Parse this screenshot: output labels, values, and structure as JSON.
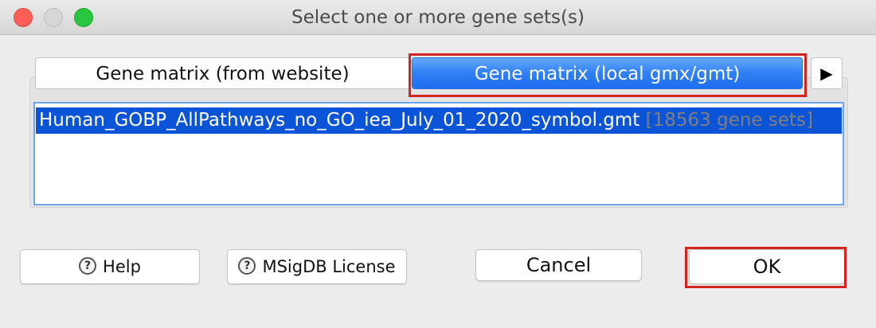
{
  "window": {
    "title": "Select one or more gene sets(s)"
  },
  "tabs": [
    {
      "label": "Gene matrix (from website)"
    },
    {
      "label": "Gene matrix (local gmx/gmt)"
    }
  ],
  "tab_scroll_icon": "▶",
  "list": {
    "items": [
      {
        "name": "Human_GOBP_AllPathways_no_GO_iea_July_01_2020_symbol.gmt",
        "count": "[18563 gene sets]"
      }
    ]
  },
  "buttons": {
    "help": "Help",
    "license": "MSigDB License",
    "cancel": "Cancel",
    "ok": "OK"
  },
  "help_icon_glyph": "?",
  "colors": {
    "selection": "#0b53d7",
    "highlight": "#d3241f",
    "active_tab": "#2f7ff4"
  }
}
